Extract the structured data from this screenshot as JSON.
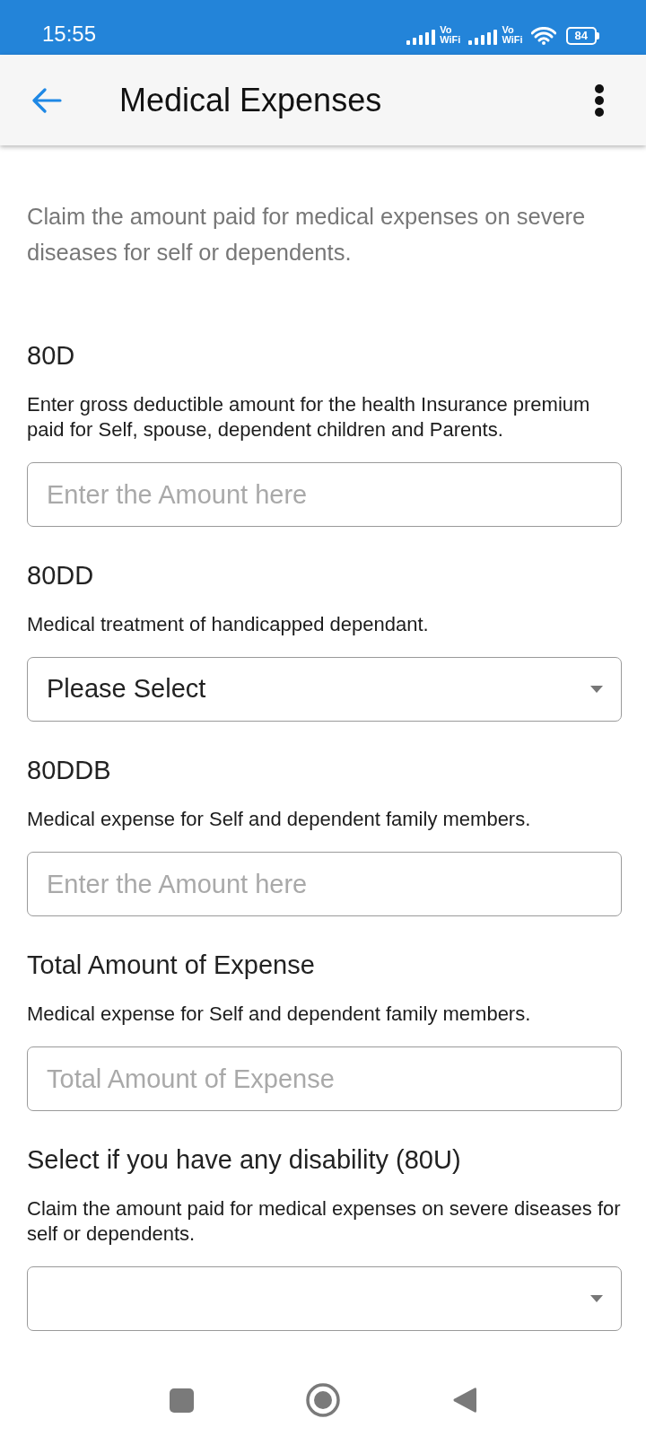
{
  "status_bar": {
    "time": "15:55",
    "sims": [
      {
        "label_top": "Vo",
        "label_bottom": "WiFi"
      },
      {
        "label_top": "Vo",
        "label_bottom": "WiFi"
      }
    ],
    "battery": "84"
  },
  "app_bar": {
    "title": "Medical Expenses"
  },
  "intro": "Claim the amount paid for medical expenses on severe diseases for self or dependents.",
  "fields": [
    {
      "kind": "input",
      "heading": "80D",
      "description": "Enter gross deductible amount for the health Insurance premium paid for Self, spouse, dependent children and Parents.",
      "placeholder": "Enter the Amount here"
    },
    {
      "kind": "select",
      "heading": "80DD",
      "description": "Medical treatment of handicapped dependant.",
      "value": "Please Select"
    },
    {
      "kind": "input",
      "heading": "80DDB",
      "description": "Medical expense for Self and dependent family members.",
      "placeholder": "Enter the Amount here"
    },
    {
      "kind": "input",
      "heading": "Total Amount of Expense",
      "description": "Medical expense for Self and dependent family members.",
      "placeholder": "Total Amount of Expense"
    },
    {
      "kind": "select",
      "heading": "Select if you have any disability (80U)",
      "description": "Claim the amount paid for medical expenses on severe diseases for self or dependents."
    }
  ]
}
